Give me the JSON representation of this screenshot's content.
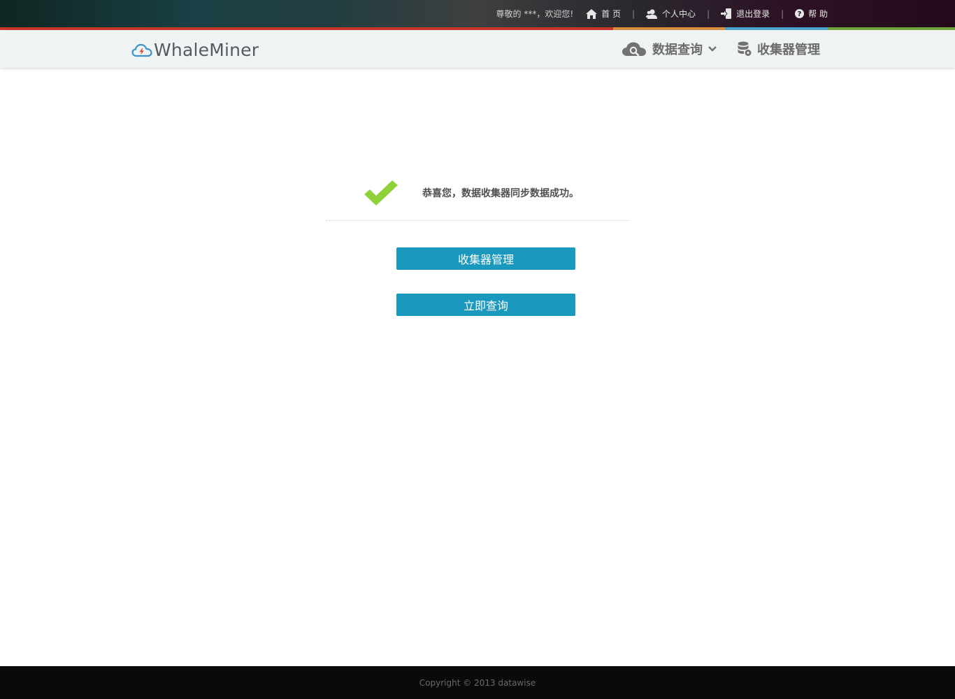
{
  "topbar": {
    "welcome": "尊敬的 ***，欢迎您!",
    "links": [
      {
        "label": "首 页",
        "icon": "home-icon"
      },
      {
        "label": "个人中心",
        "icon": "user-icon"
      },
      {
        "label": "退出登录",
        "icon": "logout-icon"
      },
      {
        "label": "帮 助",
        "icon": "help-icon"
      }
    ],
    "separator": "|"
  },
  "header": {
    "logo_text": "WhaleMiner",
    "nav": [
      {
        "label": "数据查询",
        "icon": "cloud-search-icon",
        "has_dropdown": true
      },
      {
        "label": "收集器管理",
        "icon": "database-gear-icon"
      }
    ]
  },
  "main": {
    "success_message": "恭喜您，数据收集器同步数据成功。",
    "buttons": [
      {
        "label": "收集器管理"
      },
      {
        "label": "立即查询"
      }
    ]
  },
  "footer": {
    "copyright": "Copyright © 2013 datawise"
  },
  "colors": {
    "primary_button": "#1a98bd",
    "check": "#8fd13a",
    "stripe": [
      "#c8382a",
      "#d98e3d",
      "#4aa1c9",
      "#6fa53b"
    ]
  }
}
